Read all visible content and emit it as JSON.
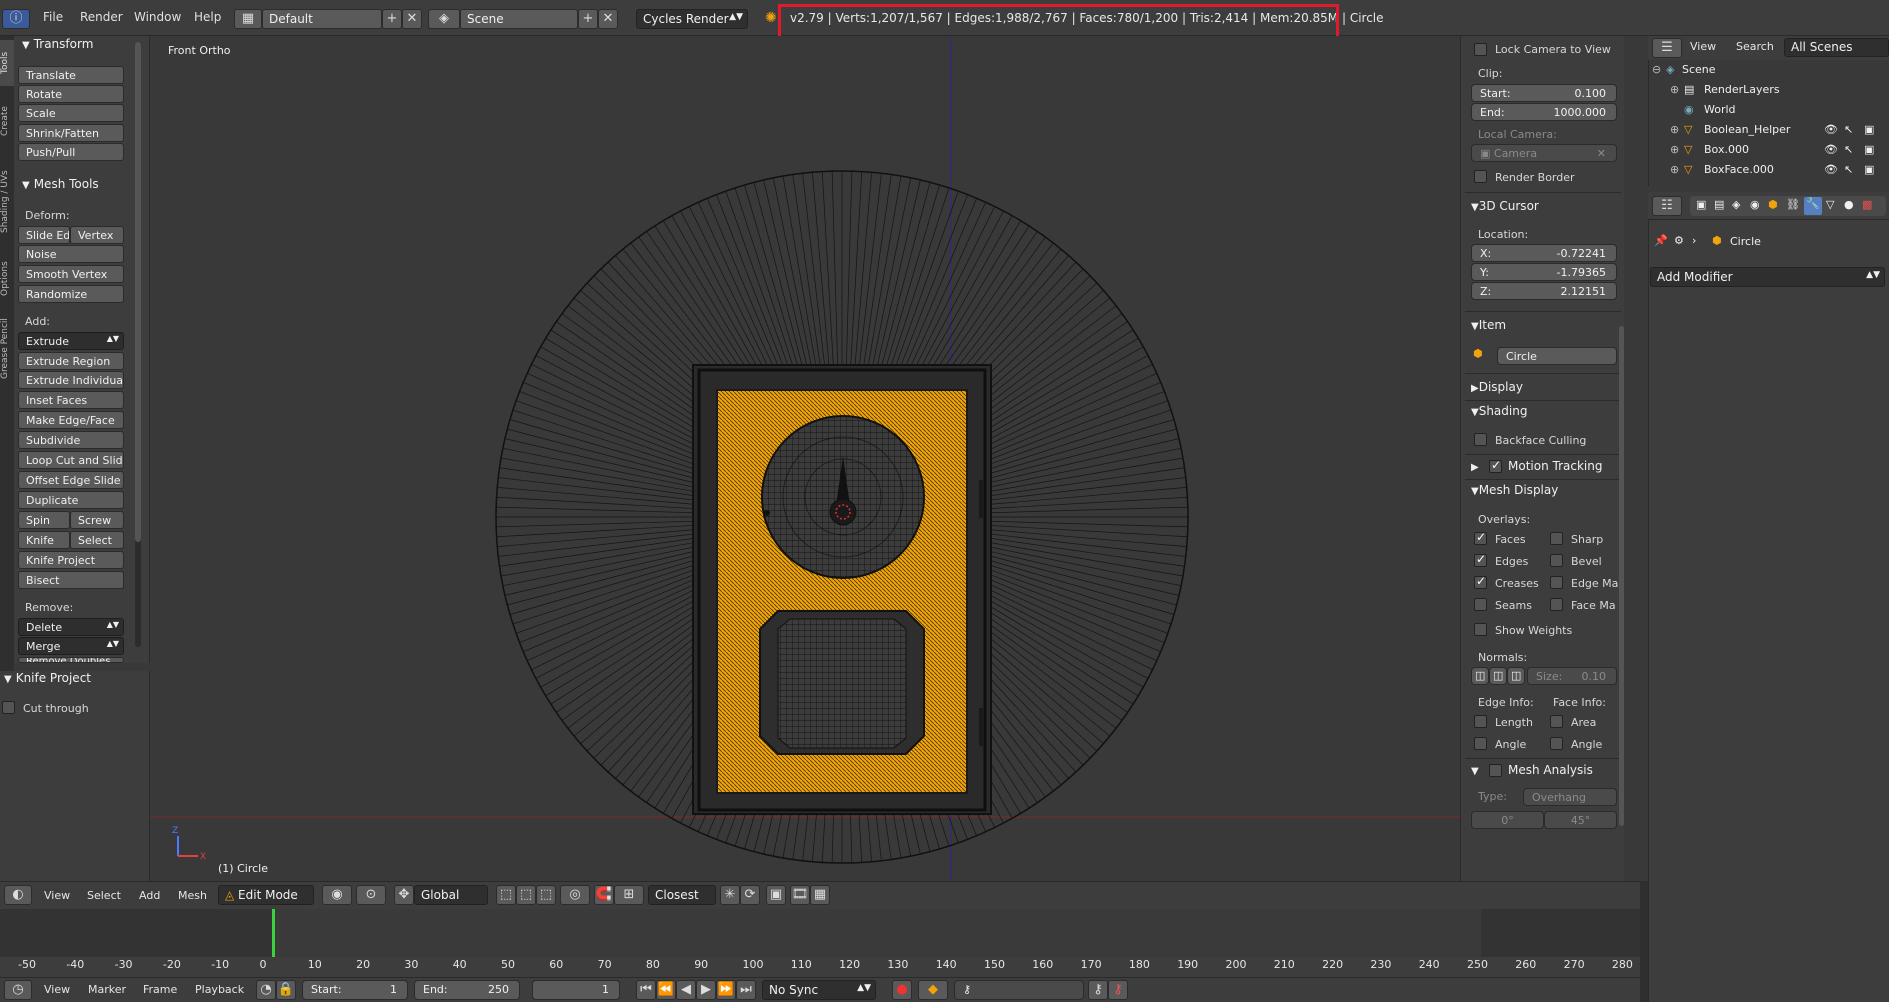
{
  "topbar": {
    "menus": [
      "File",
      "Render",
      "Window",
      "Help"
    ],
    "layout": "Default",
    "scene": "Scene",
    "engine": "Cycles Render",
    "stats": "v2.79 | Verts:1,207/1,567 | Edges:1,988/2,767 | Faces:780/1,200 | Tris:2,414 | Mem:20.85M | Circle"
  },
  "left_tabs": [
    "Tools",
    "Create",
    "Shading / UVs",
    "Options",
    "Grease Pencil"
  ],
  "toolshelf": {
    "transform_header": "Transform",
    "transform": [
      "Translate",
      "Rotate",
      "Scale",
      "Shrink/Fatten",
      "Push/Pull"
    ],
    "meshtools_header": "Mesh Tools",
    "deform_label": "Deform:",
    "slide_edge": "Slide Ed",
    "vertex": "Vertex",
    "deform": [
      "Noise",
      "Smooth Vertex",
      "Randomize"
    ],
    "add_label": "Add:",
    "extrude_menu": "Extrude",
    "add": [
      "Extrude Region",
      "Extrude Individual",
      "Inset Faces",
      "Make Edge/Face",
      "Subdivide",
      "Loop Cut and Slide",
      "Offset Edge Slide",
      "Duplicate"
    ],
    "spin": "Spin",
    "screw": "Screw",
    "knife": "Knife",
    "select": "Select",
    "knife_project": "Knife Project",
    "bisect": "Bisect",
    "remove_label": "Remove:",
    "delete": "Delete",
    "merge": "Merge",
    "remove_doubles": "Remove Doubles",
    "knife_panel_header": "Knife Project",
    "cut_through": "Cut through"
  },
  "viewport": {
    "title": "Front Ortho",
    "object_label": "(1) Circle"
  },
  "npanel": {
    "lock_camera": "Lock Camera to View",
    "clip_label": "Clip:",
    "clip_start_label": "Start:",
    "clip_start": "0.100",
    "clip_end_label": "End:",
    "clip_end": "1000.000",
    "local_camera_label": "Local Camera:",
    "camera": "Camera",
    "render_border": "Render Border",
    "cursor_header": "3D Cursor",
    "location_label": "Location:",
    "x_label": "X:",
    "x": "-0.72241",
    "y_label": "Y:",
    "y": "-1.79365",
    "z_label": "Z:",
    "z": "2.12151",
    "item_header": "Item",
    "item_name": "Circle",
    "display_header": "Display",
    "shading_header": "Shading",
    "backface": "Backface Culling",
    "motion_tracking": "Motion Tracking",
    "mesh_display_header": "Mesh Display",
    "overlays_label": "Overlays:",
    "faces": "Faces",
    "sharp": "Sharp",
    "edges": "Edges",
    "bevel": "Bevel",
    "creases": "Creases",
    "edge_marks": "Edge Ma",
    "seams": "Seams",
    "face_marks": "Face Ma",
    "show_weights": "Show Weights",
    "normals_label": "Normals:",
    "size_label": "Size:",
    "size": "0.10",
    "edge_info_label": "Edge Info:",
    "face_info_label": "Face Info:",
    "length": "Length",
    "area": "Area",
    "angle": "Angle",
    "angle2": "Angle",
    "mesh_analysis_header": "Mesh Analysis",
    "type_label": "Type:",
    "type_value": "Overhang",
    "min_angle": "0°",
    "max_angle": "45°"
  },
  "outliner": {
    "view": "View",
    "search": "Search",
    "filter": "All Scenes",
    "items": [
      "Scene",
      "RenderLayers",
      "World",
      "Boolean_Helper",
      "Box.000",
      "BoxFace.000"
    ]
  },
  "properties": {
    "object": "Circle",
    "add_modifier": "Add Modifier"
  },
  "viewport_header": {
    "menus": [
      "View",
      "Select",
      "Add",
      "Mesh"
    ],
    "mode": "Edit Mode",
    "orientation": "Global",
    "snap": "Closest"
  },
  "timeline": {
    "ticks": [
      "-50",
      "-40",
      "-30",
      "-20",
      "-10",
      "0",
      "10",
      "20",
      "30",
      "40",
      "50",
      "60",
      "70",
      "80",
      "90",
      "100",
      "110",
      "120",
      "130",
      "140",
      "150",
      "160",
      "170",
      "180",
      "190",
      "200",
      "210",
      "220",
      "230",
      "240",
      "250",
      "260",
      "270",
      "280"
    ],
    "menus": [
      "View",
      "Marker",
      "Frame",
      "Playback"
    ],
    "start_label": "Start:",
    "start": "1",
    "end_label": "End:",
    "end": "250",
    "current": "1",
    "sync": "No Sync"
  },
  "colors": {
    "accent_orange": "#f0a30a",
    "highlight_red": "#e0192b",
    "viewport_bg": "#393939"
  }
}
